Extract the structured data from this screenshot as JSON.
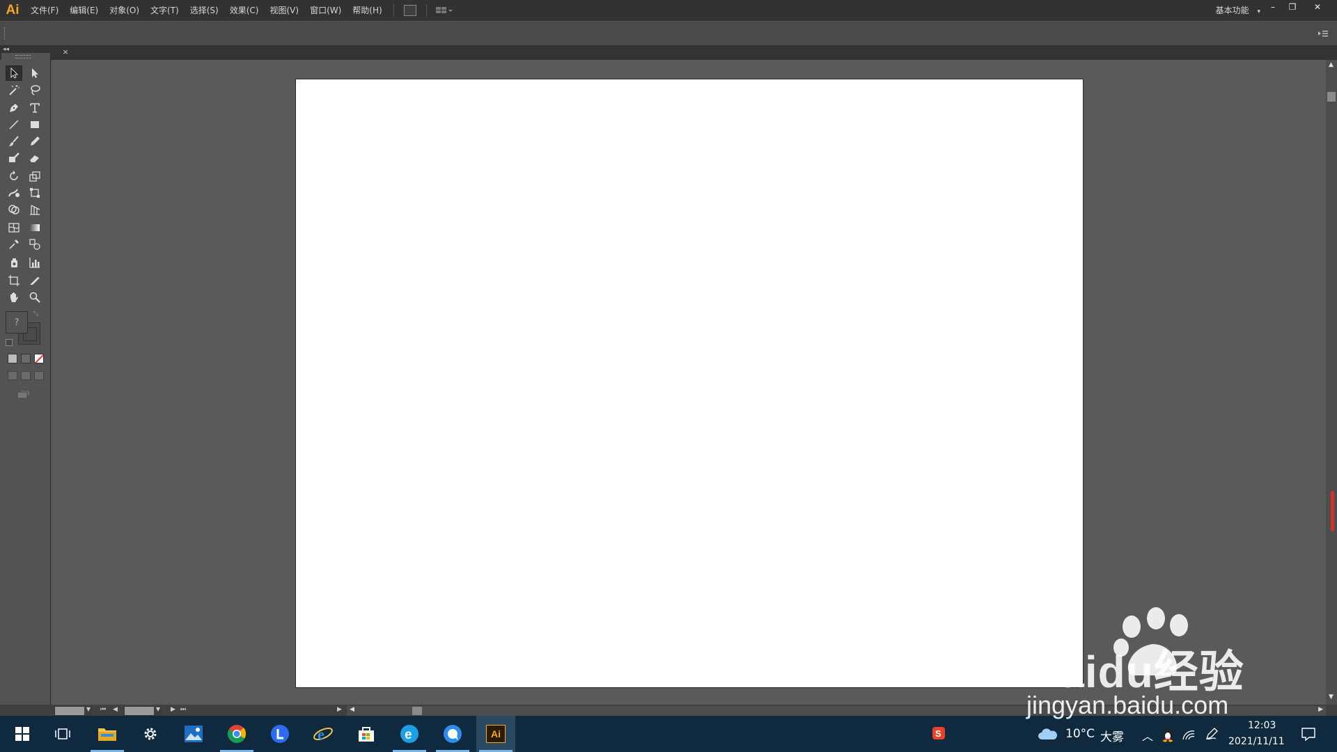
{
  "app": {
    "logo_text": "Ai",
    "workspace_label": "基本功能"
  },
  "menu": [
    "文件(F)",
    "编辑(E)",
    "对象(O)",
    "文字(T)",
    "选择(S)",
    "效果(C)",
    "视图(V)",
    "窗口(W)",
    "帮助(H)"
  ],
  "window_controls": {
    "minimize": "–",
    "restore": "❐",
    "close": "✕"
  },
  "document_tab": {
    "close": "×"
  },
  "tools": {
    "fill_stroke_unknown": "?"
  },
  "taskbar": {
    "weather_temp": "10°C",
    "weather_desc": "大雾",
    "time": "12:03",
    "date": "2021/11/11",
    "active_app_label": "Ai"
  },
  "watermark": {
    "brand": "Baidu经验",
    "url": "jingyan.baidu.com"
  },
  "colors": {
    "menubar": "#323232",
    "panel": "#535353",
    "canvas": "#5a5a5a",
    "artboard": "#ffffff",
    "ai_orange": "#f7a81b",
    "taskbar": "#0f2a3f"
  }
}
